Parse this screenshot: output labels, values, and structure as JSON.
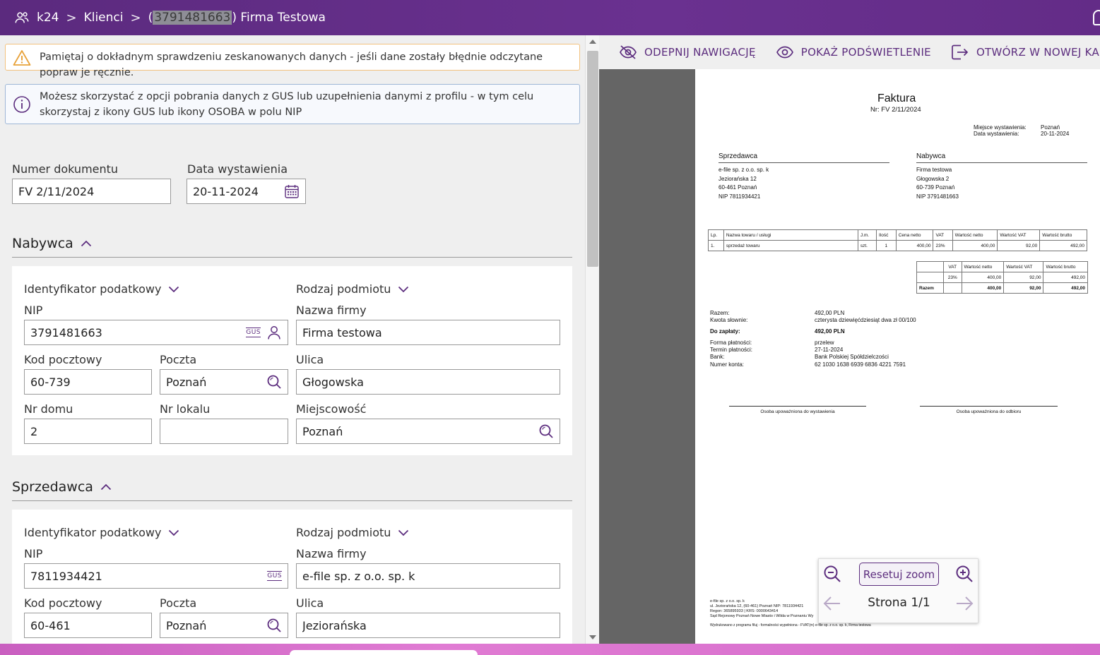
{
  "header": {
    "app_name": "k24",
    "crumb_clients": "Klienci",
    "paren_open": "(",
    "client_nip_highlight": "3791481663",
    "client_name": ") Firma Testowa",
    "separator": ">"
  },
  "alerts": {
    "warning": "Pamiętaj o dokładnym sprawdzeniu zeskanowanych danych - jeśli dane zostały błędnie odczytane popraw je ręcznie.",
    "info": "Możesz skorzystać z opcji pobrania danych z GUS lub uzupełnienia danymi z profilu - w tym celu skorzystaj z ikony GUS lub ikony OSOBA w polu NIP"
  },
  "document": {
    "number_label": "Numer dokumentu",
    "number_value": "FV 2/11/2024",
    "date_label": "Data wystawienia",
    "date_value": "20-11-2024"
  },
  "buyer": {
    "section_title": "Nabywca",
    "tax_id_dropdown": "Identyfikator podatkowy",
    "entity_type_dropdown": "Rodzaj podmiotu",
    "nip_label": "NIP",
    "nip_value": "3791481663",
    "company_label": "Nazwa firmy",
    "company_value": "Firma testowa",
    "postal_label": "Kod pocztowy",
    "postal_value": "60-739",
    "post_label": "Poczta",
    "post_value": "Poznań",
    "street_label": "Ulica",
    "street_value": "Głogowska",
    "house_label": "Nr domu",
    "house_value": "2",
    "flat_label": "Nr lokalu",
    "flat_value": "",
    "city_label": "Miejscowość",
    "city_value": "Poznań"
  },
  "seller": {
    "section_title": "Sprzedawca",
    "tax_id_dropdown": "Identyfikator podatkowy",
    "entity_type_dropdown": "Rodzaj podmiotu",
    "nip_label": "NIP",
    "nip_value": "7811934421",
    "company_label": "Nazwa firmy",
    "company_value": "e-file sp. z o.o. sp. k",
    "postal_label": "Kod pocztowy",
    "postal_value": "60-461",
    "post_label": "Poczta",
    "post_value": "Poznań",
    "street_label": "Ulica",
    "street_value": "Jeziorańska"
  },
  "gus_badge": "GUS",
  "toolbar": {
    "unpin_nav": "ODEPNIJ NAWIGACJĘ",
    "show_highlight": "POKAŻ PODŚWIETLENIE",
    "open_new_tab": "OTWÓRZ W NOWEJ KARCIE"
  },
  "viewer": {
    "reset_zoom": "Resetuj zoom",
    "page_indicator": "Strona 1/1"
  },
  "invoice": {
    "title": "Faktura",
    "number": "Nr: FV 2/11/2024",
    "place_label": "Miejsce wystawienia:",
    "place_value": "Poznań",
    "date_label": "Data wystawienia:",
    "date_value": "20-11-2024",
    "seller_head": "Sprzedawca",
    "seller_lines": [
      "e-file sp. z o.o. sp. k",
      "Jeziorańska 12",
      "60-461 Poznań",
      "NIP 7811934421"
    ],
    "buyer_head": "Nabywca",
    "buyer_lines": [
      "Firma testowa",
      "Głogowska 2",
      "60-739 Poznań",
      "NIP 3791481663"
    ],
    "items_header": [
      "Lp.",
      "Nazwa towaru / usługi",
      "J.m.",
      "Ilość",
      "Cena netto",
      "VAT",
      "Wartość netto",
      "Wartość VAT",
      "Wartość brutto"
    ],
    "items": [
      [
        "1.",
        "sprzedaż towaru",
        "szt.",
        "1",
        "400,00",
        "23%",
        "400,00",
        "92,00",
        "492,00"
      ]
    ],
    "summary_header": [
      "",
      "VAT",
      "Wartość netto",
      "Wartość VAT",
      "Wartość brutto"
    ],
    "summary_rows": [
      [
        "",
        "23%",
        "400,00",
        "92,00",
        "492,00"
      ],
      [
        "Razem",
        "",
        "400,00",
        "92,00",
        "492,00"
      ]
    ],
    "totals": [
      {
        "label": "Razem:",
        "value": "492,00 PLN"
      },
      {
        "label": "Kwota słownie:",
        "value": "czterysta dziewięćdziesiąt dwa zł 00/100"
      },
      {
        "label": "Do zapłaty:",
        "value": "492,00 PLN"
      },
      {
        "label": "Forma płatności:",
        "value": "przelew"
      },
      {
        "label": "Termin płatności:",
        "value": "27-11-2024"
      },
      {
        "label": "Bank:",
        "value": "Bank Polskiej Spółdzielczości"
      },
      {
        "label": "Numer konta:",
        "value": "62 1030 1638 6939 6836 4221 7591"
      }
    ],
    "sign_issuer": "Osoba upoważniona do wystawienia",
    "sign_receiver": "Osoba upoważniona do odbioru",
    "footer_lines": [
      "e-file sp. z o.o. sp. k",
      "ul. Jeziorańska 12, (60-461) Poznań NIP: 7811934421",
      "Regon: 365895933 | KRS: 0000643414",
      "Sąd Rejonowy Poznań Nowe Miasto i Wilda w Poznaniu Wy",
      "Wydrukowano z programu filuj - formalności wypełniona - FVAT(m) e-file sp. z o.o. sp. k, Firma testowa"
    ]
  },
  "colors": {
    "brand_purple": "#5c2d7e",
    "warning_border": "#f3c27e",
    "info_border": "#9fb7d6"
  }
}
